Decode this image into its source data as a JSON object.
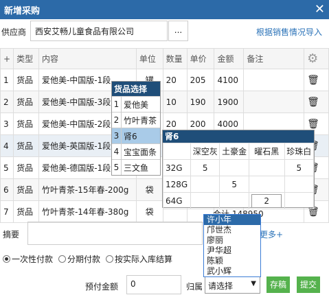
{
  "window": {
    "title": "新增采购",
    "close_glyph": "✕"
  },
  "supplier": {
    "label": "供应商",
    "value": "西安艾畅儿童食品有限公司",
    "picker_label": "...",
    "import_link": "根据销售情况导入"
  },
  "table": {
    "headers": [
      "+",
      "类型",
      "内容",
      "单位",
      "数量",
      "单价",
      "金额",
      "备注",
      "⚙"
    ],
    "rows": [
      {
        "no": "1",
        "type": "货品",
        "content": "爱他美-中国版-1段",
        "unit": "罐",
        "qty": "20",
        "price": "205",
        "amount": "4100",
        "note": ""
      },
      {
        "no": "2",
        "type": "货品",
        "content": "爱他美-中国版-3段",
        "unit": "罐",
        "qty": "10",
        "price": "190",
        "amount": "1900",
        "note": ""
      },
      {
        "no": "3",
        "type": "货品",
        "content": "爱他美-中国版-2段",
        "unit": "罐",
        "qty": "20",
        "price": "200",
        "amount": "4000",
        "note": ""
      },
      {
        "no": "4",
        "type": "货品",
        "content": "爱他美-英国版-1段",
        "unit": "",
        "qty": "",
        "price": "",
        "amount": "",
        "note": ""
      },
      {
        "no": "5",
        "type": "货品",
        "content": "爱他美-德国版-1段",
        "unit": "",
        "qty": "",
        "price": "",
        "amount": "",
        "note": ""
      },
      {
        "no": "6",
        "type": "货品",
        "content": "竹叶青茶-15年春-200g",
        "unit": "袋",
        "qty": "",
        "price": "",
        "amount": "",
        "note": ""
      },
      {
        "no": "7",
        "type": "货品",
        "content": "竹叶青茶-14年春-380g",
        "unit": "袋",
        "qty": "",
        "price": "",
        "amount": "",
        "note": ""
      }
    ]
  },
  "goods_popup": {
    "title": "货品选择",
    "items": [
      {
        "n": "1",
        "label": "爱他美"
      },
      {
        "n": "2",
        "label": "竹叶青茶"
      },
      {
        "n": "3",
        "label": "肾6"
      },
      {
        "n": "4",
        "label": "宝宝面条"
      },
      {
        "n": "5",
        "label": "三文鱼"
      }
    ]
  },
  "variant_popup": {
    "title": "肾6",
    "colors": [
      "深空灰",
      "土豪金",
      "曜石黑",
      "珍珠白"
    ],
    "rows": [
      {
        "size": "32G",
        "cells": [
          "5",
          "",
          "",
          "5"
        ]
      },
      {
        "size": "128G",
        "cells": [
          "",
          "5",
          "",
          ""
        ]
      },
      {
        "size": "64G",
        "cells": [
          "",
          "",
          "2",
          ""
        ]
      }
    ]
  },
  "total": {
    "label": "合计",
    "value": "148950"
  },
  "remark": {
    "label": "摘要",
    "more": "更多+"
  },
  "payment": {
    "options": [
      "一次性付款",
      "分期付款",
      "按实际入库结算"
    ],
    "selected": 0
  },
  "prepay": {
    "label": "预付金额",
    "value": "0"
  },
  "owner": {
    "label": "归属",
    "options": [
      "许小年",
      "邝世杰",
      "廖丽",
      "尹华超",
      "陈颖",
      "武小辉"
    ],
    "highlighted": 0,
    "select_value": "请选择"
  },
  "buttons": {
    "draft": "存稿",
    "submit": "提交"
  }
}
